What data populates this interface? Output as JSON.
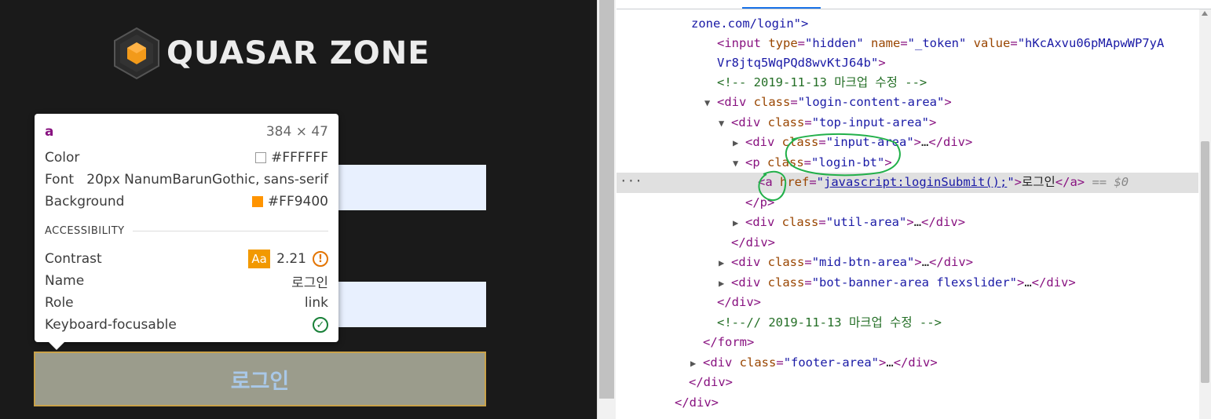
{
  "page": {
    "logo_text": "QUASAR ZONE",
    "login_button_label": "로그인"
  },
  "tooltip": {
    "tag": "a",
    "size": "384 × 47",
    "color_label": "Color",
    "color_value": "#FFFFFF",
    "font_label": "Font",
    "font_value": "20px NanumBarunGothic, sans-serif",
    "background_label": "Background",
    "background_value": "#FF9400",
    "accessibility_heading": "ACCESSIBILITY",
    "contrast_label": "Contrast",
    "contrast_badge": "Aa",
    "contrast_value": "2.21",
    "name_label": "Name",
    "name_value": "로그인",
    "role_label": "Role",
    "role_value": "link",
    "keyboard_label": "Keyboard-focusable",
    "colors": {
      "swatch_color": "#FFFFFF",
      "swatch_background": "#FF9400",
      "warning": "#E37400",
      "ok": "#188038"
    }
  },
  "devtools": {
    "lines": {
      "l0": "zone.com/login\">",
      "l1_tag_open": "<input ",
      "l1_attr1": "type",
      "l1_val1": "\"hidden\"",
      "l1_attr2": "name",
      "l1_val2": "\"_token\"",
      "l1_attr3": "value",
      "l1_val3a": "\"hKcAxvu06pMApwWP7yA",
      "l2_val3b": "Vr8jtq5WqPQd8wvKtJ64b\"",
      "l3_comment": "<!-- 2019-11-13 마크업 수정 -->",
      "l4_class": "\"login-content-area\"",
      "l5_class": "\"top-input-area\"",
      "l6_class": "\"input-area\"",
      "l7_class": "\"login-bt\"",
      "l8_href": "javascript:loginSubmit();",
      "l8_text": "로그인",
      "l8_eq": "== $0",
      "l10_class": "\"util-area\"",
      "l12_class": "\"mid-btn-area\"",
      "l13_class": "\"bot-banner-area flexslider\"",
      "l15_comment": "<!--// 2019-11-13 마크업 수정 -->",
      "l17_class": "\"footer-area\""
    }
  }
}
